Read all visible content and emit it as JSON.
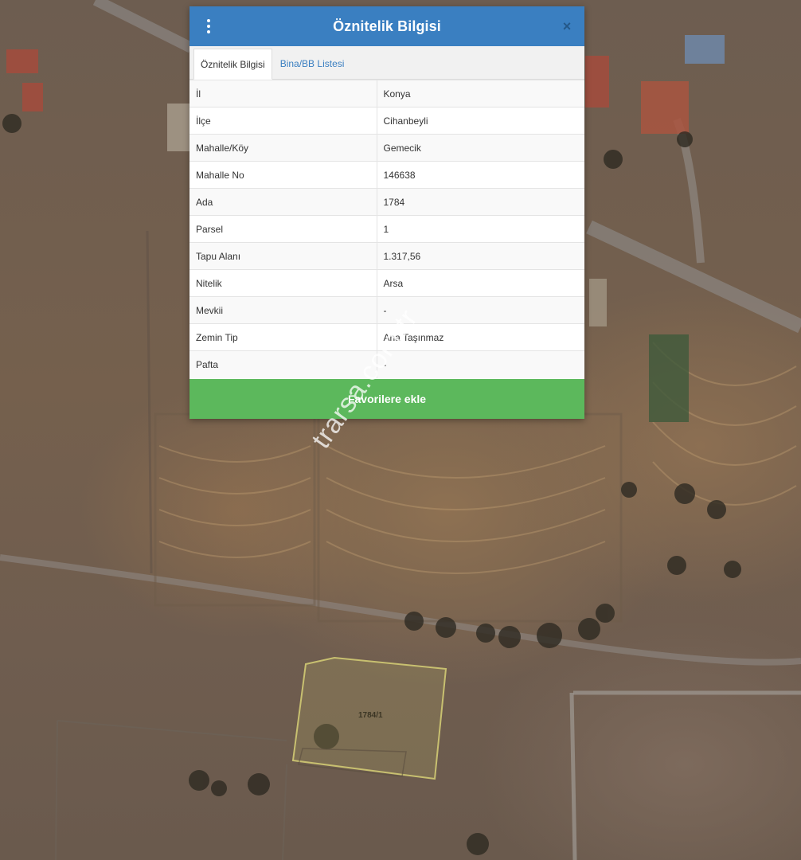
{
  "dialog": {
    "title": "Öznitelik Bilgisi",
    "close_glyph": "×",
    "tabs": [
      {
        "label": "Öznitelik Bilgisi",
        "active": true
      },
      {
        "label": "Bina/BB Listesi",
        "active": false
      }
    ],
    "rows": [
      {
        "key": "İl",
        "value": "Konya"
      },
      {
        "key": "İlçe",
        "value": "Cihanbeyli"
      },
      {
        "key": "Mahalle/Köy",
        "value": "Gemecik"
      },
      {
        "key": "Mahalle No",
        "value": "146638"
      },
      {
        "key": "Ada",
        "value": "1784"
      },
      {
        "key": "Parsel",
        "value": "1"
      },
      {
        "key": "Tapu Alanı",
        "value": "1.317,56"
      },
      {
        "key": "Nitelik",
        "value": "Arsa"
      },
      {
        "key": "Mevkii",
        "value": "-"
      },
      {
        "key": "Zemin Tip",
        "value": "Ana Taşınmaz"
      },
      {
        "key": "Pafta",
        "value": "-"
      }
    ],
    "favorite_label": "Favorilere ekle"
  },
  "map": {
    "parcel_label": "1784/1",
    "watermark": "trarsa.com.tr"
  },
  "colors": {
    "header": "#3a7fc1",
    "favorite": "#5cb85c",
    "parcel_outline": "#c8c070"
  }
}
